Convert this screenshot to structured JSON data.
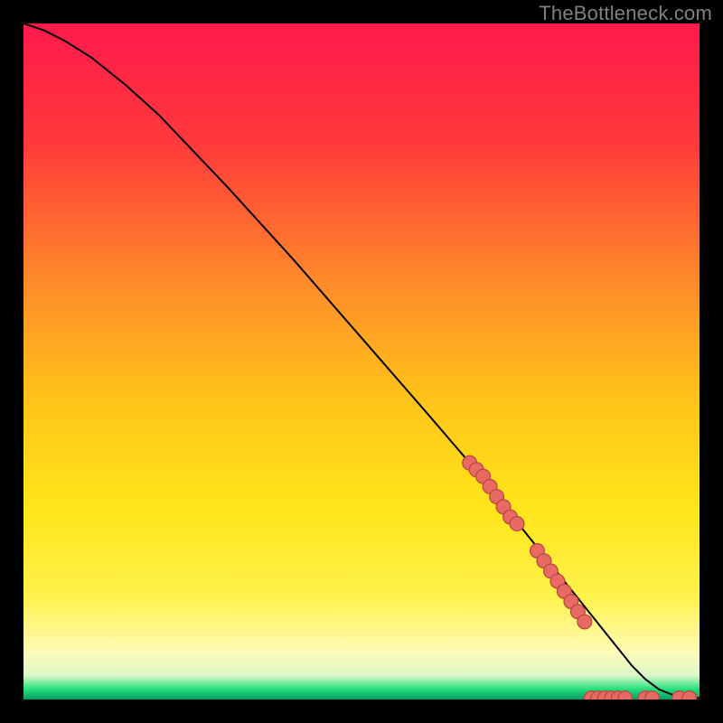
{
  "attribution": "TheBottleneck.com",
  "colors": {
    "bg_black": "#000000",
    "grad_top": "#ff1a4d",
    "grad_mid_upper": "#ff6a2a",
    "grad_mid": "#ffd21a",
    "grad_lower": "#fff24d",
    "grad_pale": "#fffccc",
    "grad_green": "#22e07a",
    "curve": "#000000",
    "marker_fill": "#e86a62",
    "marker_stroke": "#b84a44"
  },
  "chart_data": {
    "type": "line",
    "title": "",
    "xlabel": "",
    "ylabel": "",
    "xlim": [
      0,
      100
    ],
    "ylim": [
      0,
      100
    ],
    "grid": false,
    "legend": false,
    "series": [
      {
        "name": "curve",
        "kind": "line",
        "x": [
          0,
          3,
          6,
          10,
          15,
          20,
          30,
          40,
          50,
          60,
          66,
          70,
          74,
          78,
          80,
          82,
          84,
          86,
          88,
          90,
          92,
          94,
          96,
          98,
          100
        ],
        "y": [
          100,
          99,
          97.5,
          95,
          91,
          86.5,
          76,
          65,
          53.5,
          42,
          35,
          30,
          25,
          20,
          17.5,
          15,
          12.5,
          10,
          7.5,
          5,
          3,
          1.5,
          0.7,
          0.3,
          0.2
        ]
      },
      {
        "name": "markers-diagonal",
        "kind": "scatter",
        "x": [
          66,
          67,
          68,
          69,
          70,
          71,
          72,
          73,
          76,
          77,
          78,
          79,
          80,
          81,
          82,
          83
        ],
        "y": [
          35,
          34,
          33,
          31.5,
          30,
          28.5,
          27,
          26,
          22,
          20.5,
          19,
          17.5,
          16,
          14.5,
          13,
          11.5
        ]
      },
      {
        "name": "markers-bottom",
        "kind": "scatter",
        "x": [
          84,
          85,
          86,
          87,
          88,
          89,
          92,
          93,
          97,
          98.5
        ],
        "y": [
          0.2,
          0.2,
          0.2,
          0.2,
          0.2,
          0.2,
          0.2,
          0.2,
          0.2,
          0.2
        ]
      }
    ]
  }
}
